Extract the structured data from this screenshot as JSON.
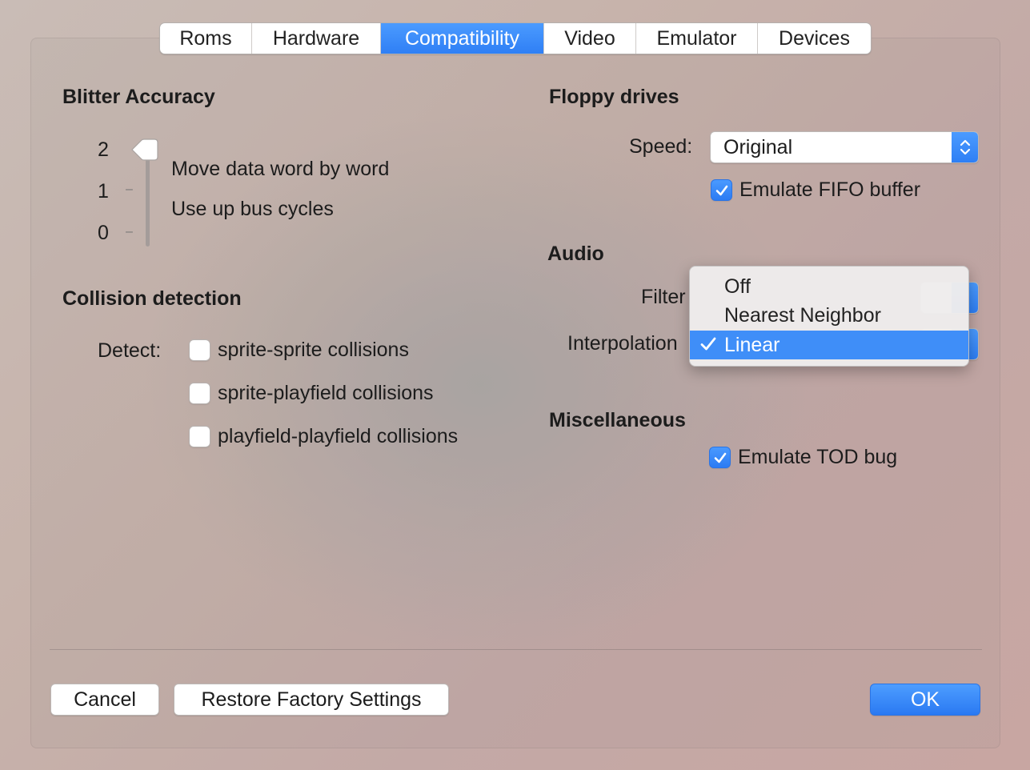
{
  "tabs": [
    {
      "label": "Roms"
    },
    {
      "label": "Hardware"
    },
    {
      "label": "Compatibility",
      "active": true
    },
    {
      "label": "Video"
    },
    {
      "label": "Emulator"
    },
    {
      "label": "Devices"
    }
  ],
  "blitter": {
    "title": "Blitter Accuracy",
    "ticks": [
      "2",
      "1",
      "0"
    ],
    "value": 2,
    "desc1": "Move data word by word",
    "desc2": "Use up bus cycles"
  },
  "collision": {
    "title": "Collision detection",
    "detect_label": "Detect:",
    "options": [
      {
        "label": "sprite-sprite collisions",
        "checked": false
      },
      {
        "label": "sprite-playfield collisions",
        "checked": false
      },
      {
        "label": "playfield-playfield collisions",
        "checked": false
      }
    ]
  },
  "floppy": {
    "title": "Floppy drives",
    "speed_label": "Speed:",
    "speed_value": "Original",
    "fifo_label": "Emulate FIFO buffer",
    "fifo_checked": true
  },
  "audio": {
    "title": "Audio",
    "filter_label": "Filter",
    "interpolation_label": "Interpolation",
    "popup_options": [
      "Off",
      "Nearest Neighbor",
      "Linear"
    ],
    "popup_selected": "Linear"
  },
  "misc": {
    "title": "Miscellaneous",
    "tod_label": "Emulate TOD bug",
    "tod_checked": true
  },
  "buttons": {
    "cancel": "Cancel",
    "restore": "Restore Factory Settings",
    "ok": "OK"
  },
  "colors": {
    "accent": "#2f7ff5",
    "selection": "#3f8ef8"
  }
}
